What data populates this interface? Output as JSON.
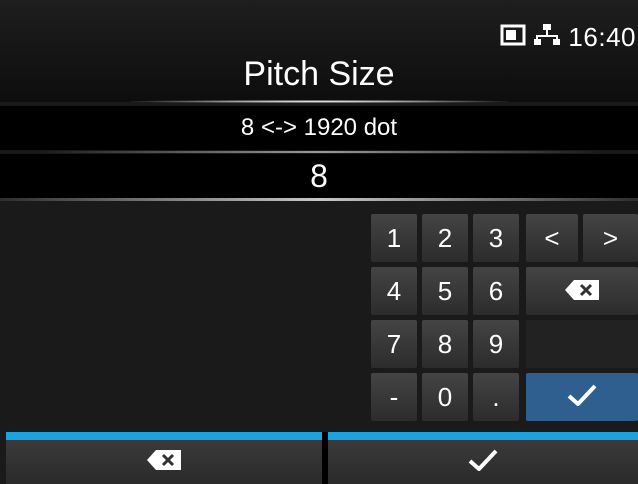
{
  "status_bar": {
    "time": "16:40",
    "icons": [
      "memory-card-icon",
      "network-icon"
    ]
  },
  "title": "Pitch Size",
  "range_text": "8 <-> 1920 dot",
  "current_value": "8",
  "keypad": {
    "digits": [
      "1",
      "2",
      "3",
      "4",
      "5",
      "6",
      "7",
      "8",
      "9",
      "0"
    ],
    "minus": "-",
    "dot": ".",
    "left": "<",
    "right": ">"
  },
  "colors": {
    "accent_blue": "#2f5f8f",
    "cyan_bar": "#19a3e1"
  }
}
